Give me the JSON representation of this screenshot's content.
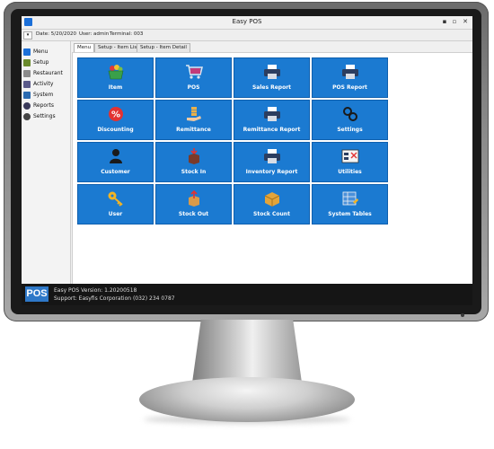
{
  "window": {
    "title": "Easy POS",
    "minimize": "▪",
    "maximize": "▫",
    "close": "✕"
  },
  "status": {
    "toggle": "▾",
    "date": "Date: 5/20/2020",
    "user": "User: admin",
    "terminal": "Terminal: 003"
  },
  "sidebar": {
    "items": [
      {
        "label": "Menu",
        "icon": "pos-icon",
        "color": "#1b6fd8"
      },
      {
        "label": "Setup",
        "icon": "setup-icon",
        "color": "#6a8a2c"
      },
      {
        "label": "Restaurant",
        "icon": "restaurant-icon",
        "color": "#8a8a8a"
      },
      {
        "label": "Activity",
        "icon": "activity-icon",
        "color": "#5a5a8a"
      },
      {
        "label": "System",
        "icon": "system-icon",
        "color": "#2a6ab0"
      },
      {
        "label": "Reports",
        "icon": "reports-icon",
        "color": "#3a3a5a"
      },
      {
        "label": "Settings",
        "icon": "settings-icon",
        "color": "#444444"
      }
    ]
  },
  "tabs": [
    {
      "label": "Menu"
    },
    {
      "label": "Setup - Item List"
    },
    {
      "label": "Setup - Item Detail"
    }
  ],
  "tiles": [
    {
      "label": "Item",
      "icon": "basket-icon"
    },
    {
      "label": "POS",
      "icon": "cart-icon"
    },
    {
      "label": "Sales Report",
      "icon": "printer-icon"
    },
    {
      "label": "POS Report",
      "icon": "printer-icon"
    },
    {
      "label": "Discounting",
      "icon": "percent-icon"
    },
    {
      "label": "Remittance",
      "icon": "money-hand-icon"
    },
    {
      "label": "Remittance Report",
      "icon": "printer-icon"
    },
    {
      "label": "Settings",
      "icon": "gears-icon"
    },
    {
      "label": "Customer",
      "icon": "person-icon"
    },
    {
      "label": "Stock In",
      "icon": "box-in-icon"
    },
    {
      "label": "Inventory Report",
      "icon": "printer-icon"
    },
    {
      "label": "Utilities",
      "icon": "utilities-icon"
    },
    {
      "label": "User",
      "icon": "key-icon"
    },
    {
      "label": "Stock Out",
      "icon": "box-out-icon"
    },
    {
      "label": "Stock Count",
      "icon": "box-count-icon"
    },
    {
      "label": "System Tables",
      "icon": "tables-icon"
    }
  ],
  "colors": {
    "tile": "#1b7ad1",
    "footer": "#151515",
    "logo": "#2e78c8"
  },
  "footer": {
    "logo_text": "POS",
    "version": "Easy POS Version: 1.20200518",
    "support": "Support: Easyfis Corporation (032) 234 0787"
  }
}
